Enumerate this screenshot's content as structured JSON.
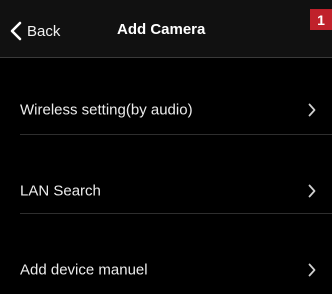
{
  "nav": {
    "back_label": "Back",
    "title": "Add Camera",
    "badge": "1"
  },
  "menu": {
    "items": [
      {
        "label": "Wireless setting(by audio)",
        "icon": "chevron-right-icon"
      },
      {
        "label": "LAN Search",
        "icon": "chevron-right-icon"
      },
      {
        "label": "Add device manuel",
        "icon": "chevron-right-icon"
      }
    ]
  },
  "colors": {
    "background": "#000000",
    "navbar": "#111111",
    "badge": "#c0212b",
    "text": "#ececec"
  }
}
